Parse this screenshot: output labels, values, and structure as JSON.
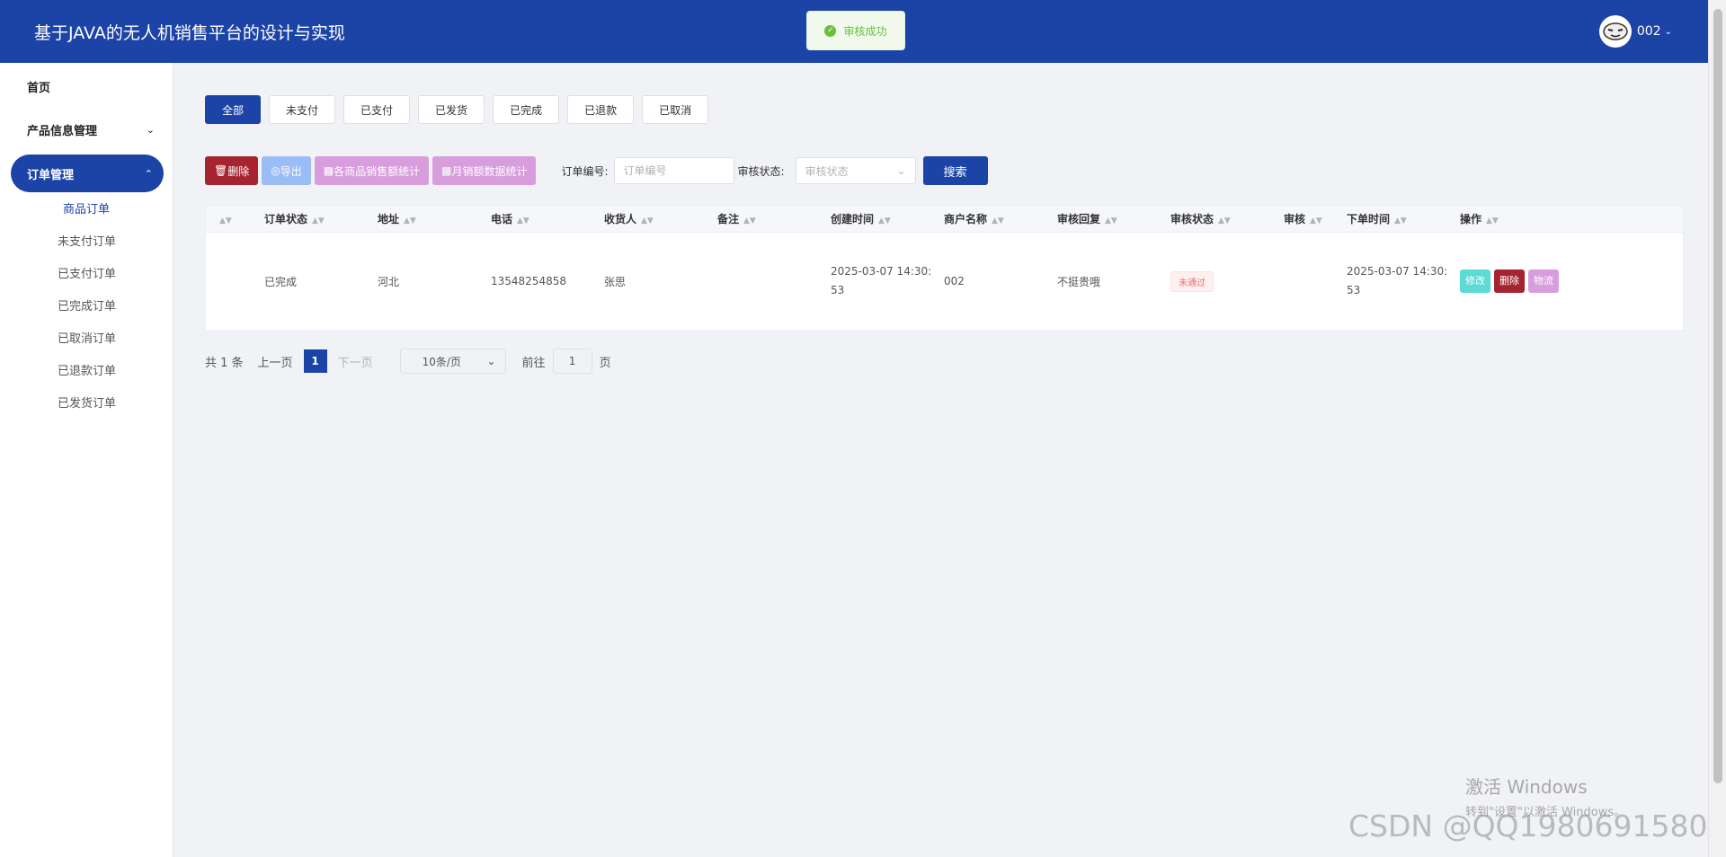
{
  "header": {
    "title": "基于JAVA的无人机销售平台的设计与实现",
    "username": "002"
  },
  "toast": {
    "text": "审核成功"
  },
  "sidebar": {
    "items": [
      {
        "label": "首页"
      },
      {
        "label": "产品信息管理"
      },
      {
        "label": "订单管理"
      }
    ],
    "submenu": [
      {
        "label": "商品订单"
      },
      {
        "label": "未支付订单"
      },
      {
        "label": "已支付订单"
      },
      {
        "label": "已完成订单"
      },
      {
        "label": "已取消订单"
      },
      {
        "label": "已退款订单"
      },
      {
        "label": "已发货订单"
      }
    ]
  },
  "tabs": [
    "全部",
    "未支付",
    "已支付",
    "已发货",
    "已完成",
    "已退款",
    "已取消"
  ],
  "toolbar": {
    "delete_label": "删除",
    "export_label": "导出",
    "stat_product_label": "各商品销售额统计",
    "stat_month_label": "月销额数据统计",
    "order_no_label": "订单编号:",
    "order_no_placeholder": "订单编号",
    "audit_label": "审核状态:",
    "audit_placeholder": "审核状态",
    "search_label": "搜索"
  },
  "table": {
    "columns": [
      "订单状态",
      "地址",
      "电话",
      "收货人",
      "备注",
      "创建时间",
      "商户名称",
      "审核回复",
      "审核状态",
      "审核",
      "下单时间",
      "操作"
    ],
    "rows": [
      {
        "status": "已完成",
        "address": "河北",
        "phone": "13548254858",
        "receiver": "张思",
        "note": "",
        "created_line1": "2025-03-07 14:30:",
        "created_line2": "53",
        "merchant": "002",
        "reply": "不挺贵哦",
        "audit_status": "未通过",
        "audit": "",
        "order_time_line1": "2025-03-07 14:30:",
        "order_time_line2": "53",
        "actions": {
          "edit": "修改",
          "delete": "删除",
          "logistics": "物流"
        }
      }
    ]
  },
  "pagination": {
    "total": "共 1 条",
    "prev": "上一页",
    "current": "1",
    "next": "下一页",
    "page_size": "10条/页",
    "goto_label": "前往",
    "goto_value": "1",
    "page_unit": "页"
  },
  "watermarks": {
    "windows_line1": "激活 Windows",
    "windows_line2": "转到\"设置\"以激活 Windows。",
    "csdn": "CSDN @QQ1980691580"
  },
  "colors": {
    "primary": "#1c43a6",
    "danger": "#a5242f",
    "export": "#9bbdf5",
    "stat": "#d89ddd",
    "edit": "#5ddad3",
    "success": "#67c23a"
  },
  "icons": [
    "user-avatar",
    "chevron-down-icon",
    "check-circle-icon",
    "trash-icon",
    "export-icon",
    "bar-chart-icon",
    "sort-icon"
  ]
}
